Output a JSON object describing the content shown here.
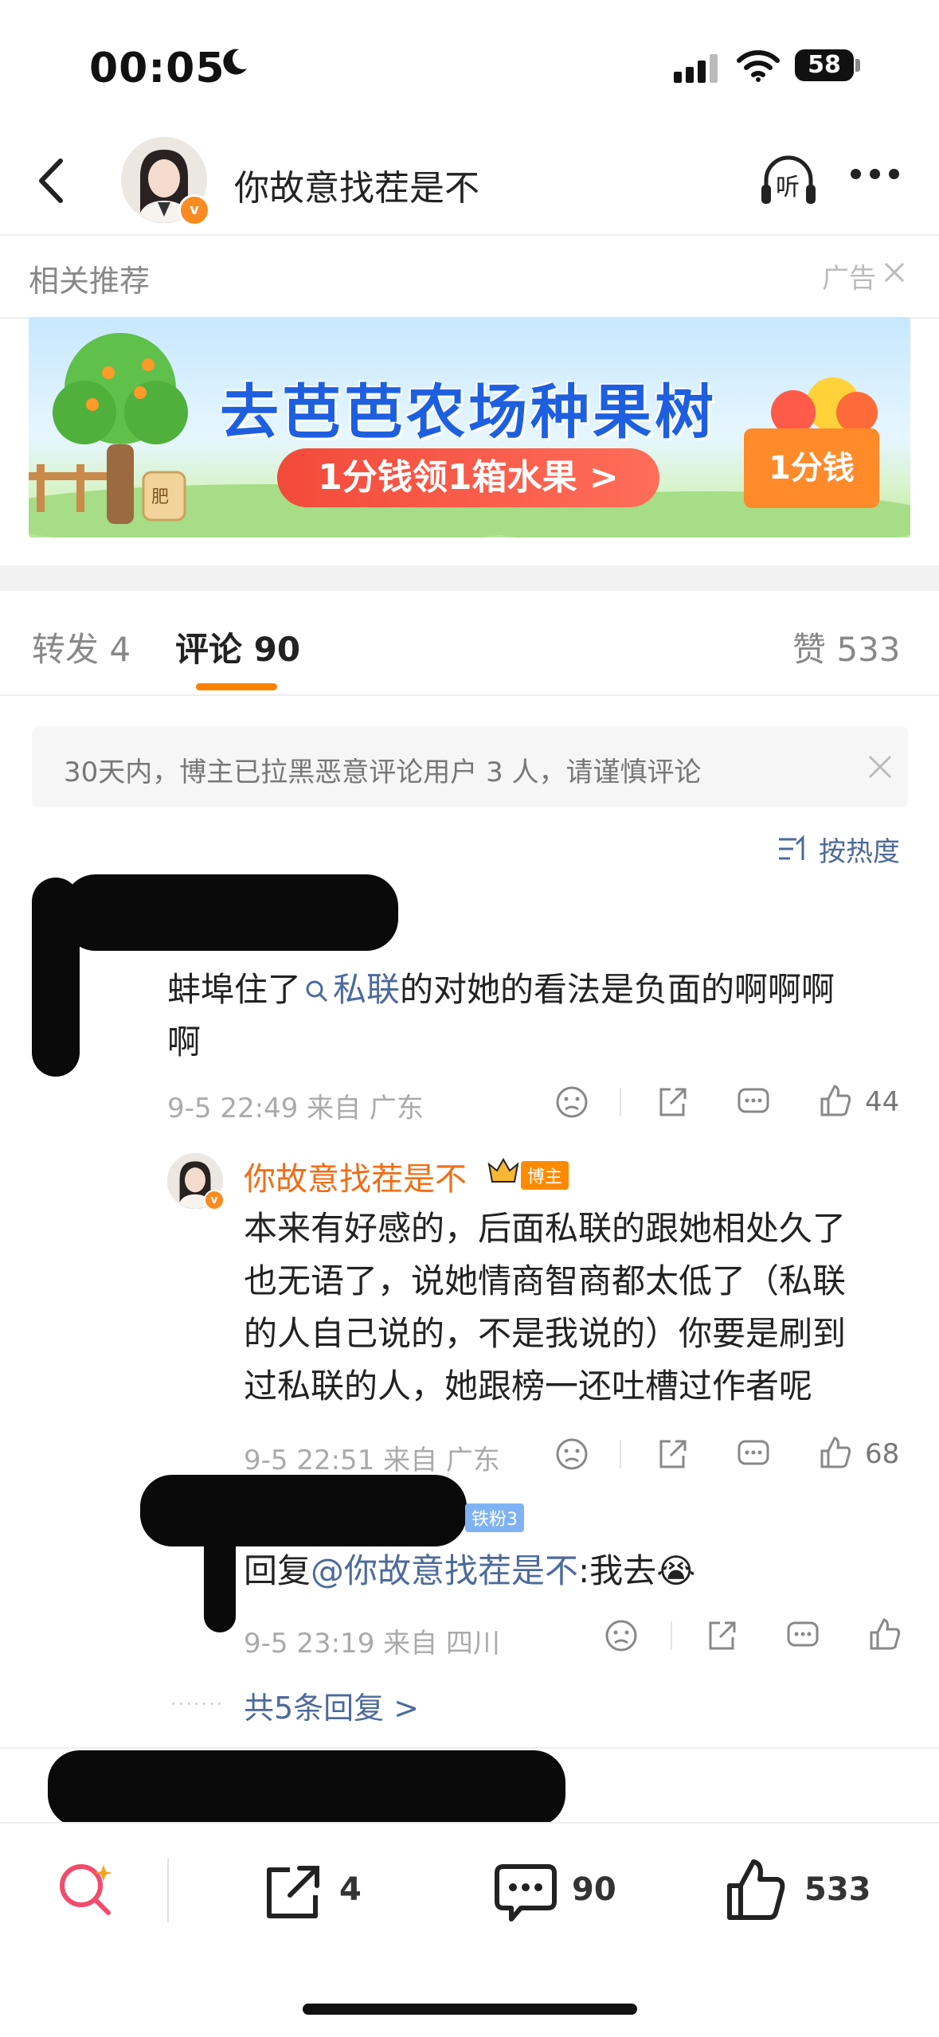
{
  "status_bar": {
    "time": "00:05",
    "battery": "58"
  },
  "nav": {
    "title": "你故意找茬是不",
    "listen_label": "听"
  },
  "related": {
    "label": "相关推荐",
    "ad_tag": "广告"
  },
  "banner": {
    "title": "去芭芭农场种果树",
    "button": "1分钱领1箱水果 >",
    "price_tag": "1分钱",
    "bag_label": "肥"
  },
  "tabs": {
    "repost": "转发 4",
    "comment": "评论 90",
    "like": "赞 533"
  },
  "notice": {
    "text": "30天内，博主已拉黑恶意评论用户 3 人，请谨慎评论"
  },
  "sort": {
    "label": "按热度"
  },
  "comments": [
    {
      "text_before": "蚌埠住了",
      "hashtag": "私联",
      "text_after": "的对她的看法是负面的啊啊啊",
      "text_line2": "啊",
      "time_location": "9-5 22:49 来自 广东",
      "likes": "44"
    }
  ],
  "replies": [
    {
      "author": "你故意找茬是不",
      "badge": "博主",
      "lines": [
        "本来有好感的，后面私联的跟她相处久了",
        "也无语了，说她情商智商都太低了（私联",
        "的人自己说的，不是我说的）你要是刷到",
        "过私联的人，她跟榜一还吐槽过作者呢"
      ],
      "time_location": "9-5 22:51 来自 广东",
      "likes": "68"
    },
    {
      "badge": "铁粉3",
      "prefix": "回复",
      "mention": "@你故意找茬是不",
      "text": ":我去",
      "emoji": "😭",
      "time_location": "9-5 23:19 来自 四川"
    }
  ],
  "more_replies": "共5条回复 >",
  "bottom": {
    "repost_count": "4",
    "comment_count": "90",
    "like_count": "533"
  },
  "colors": {
    "accent": "#ff8200",
    "link": "#4d6a9c",
    "author": "#f06d17"
  }
}
